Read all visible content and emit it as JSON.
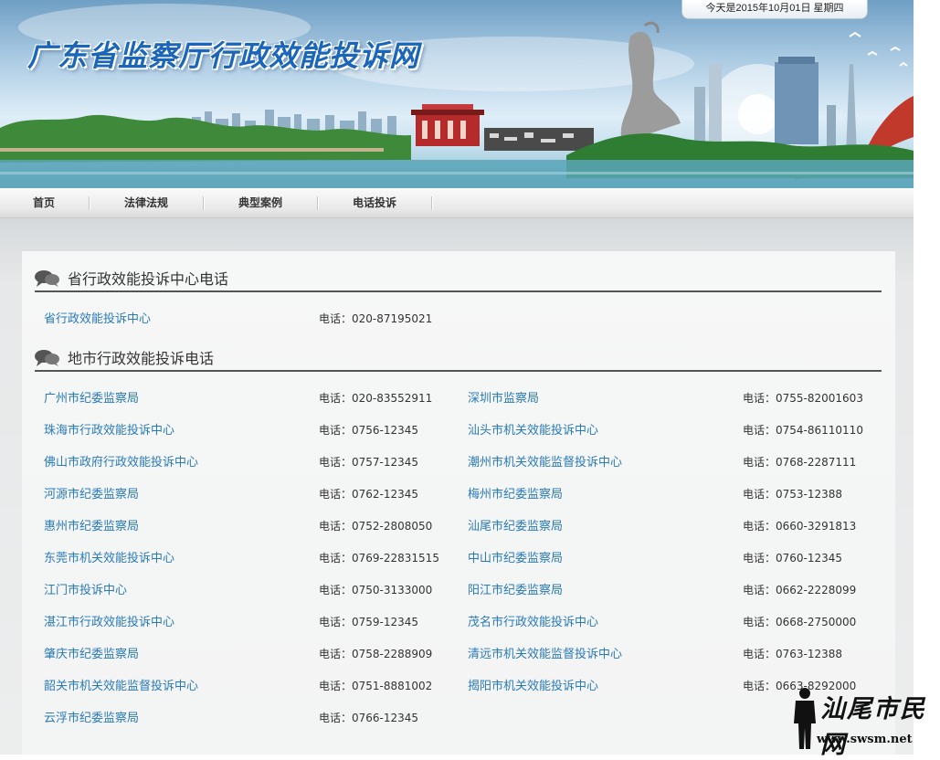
{
  "header": {
    "date_text": "今天是2015年10月01日  星期四",
    "site_title": "广东省监察厅行政效能投诉网"
  },
  "nav": {
    "items": [
      {
        "label": "首页"
      },
      {
        "label": "法律法规"
      },
      {
        "label": "典型案例"
      },
      {
        "label": "电话投诉"
      }
    ]
  },
  "colors": {
    "link": "#2a7ab8",
    "title_blue": "#1b66b8",
    "rule": "#555555"
  },
  "sections": {
    "provincial": {
      "title": "省行政效能投诉中心电话",
      "rows": [
        {
          "name": "省行政效能投诉中心",
          "phone": "电话：020-87195021"
        }
      ]
    },
    "cities": {
      "title": "地市行政效能投诉电话",
      "rows": [
        {
          "left_name": "广州市纪委监察局",
          "left_phone": "电话：020-83552911",
          "right_name": "深圳市监察局",
          "right_phone": "电话：0755-82001603"
        },
        {
          "left_name": "珠海市行政效能投诉中心",
          "left_phone": "电话：0756-12345",
          "right_name": "汕头市机关效能投诉中心",
          "right_phone": "电话：0754-86110110"
        },
        {
          "left_name": "佛山市政府行政效能投诉中心",
          "left_phone": "电话：0757-12345",
          "right_name": "潮州市机关效能监督投诉中心",
          "right_phone": "电话：0768-2287111"
        },
        {
          "left_name": "河源市纪委监察局",
          "left_phone": "电话：0762-12345",
          "right_name": "梅州市纪委监察局",
          "right_phone": "电话：0753-12388"
        },
        {
          "left_name": "惠州市纪委监察局",
          "left_phone": "电话：0752-2808050",
          "right_name": "汕尾市纪委监察局",
          "right_phone": "电话：0660-3291813"
        },
        {
          "left_name": "东莞市机关效能投诉中心",
          "left_phone": "电话：0769-22831515",
          "right_name": "中山市纪委监察局",
          "right_phone": "电话：0760-12345"
        },
        {
          "left_name": "江门市投诉中心",
          "left_phone": "电话：0750-3133000",
          "right_name": "阳江市纪委监察局",
          "right_phone": "电话：0662-2228099"
        },
        {
          "left_name": "湛江市行政效能投诉中心",
          "left_phone": "电话：0759-12345",
          "right_name": "茂名市行政效能投诉中心",
          "right_phone": "电话：0668-2750000"
        },
        {
          "left_name": "肇庆市纪委监察局",
          "left_phone": "电话：0758-2288909",
          "right_name": "清远市机关效能监督投诉中心",
          "right_phone": "电话：0763-12388"
        },
        {
          "left_name": "韶关市机关效能监督投诉中心",
          "left_phone": "电话：0751-8881002",
          "right_name": "揭阳市机关效能投诉中心",
          "right_phone": "电话：0663-8292000"
        },
        {
          "left_name": "云浮市纪委监察局",
          "left_phone": "电话：0766-12345",
          "right_name": "",
          "right_phone": ""
        }
      ]
    }
  },
  "watermark": {
    "script_text": "汕尾市民网",
    "url": "www.swsm.net"
  }
}
